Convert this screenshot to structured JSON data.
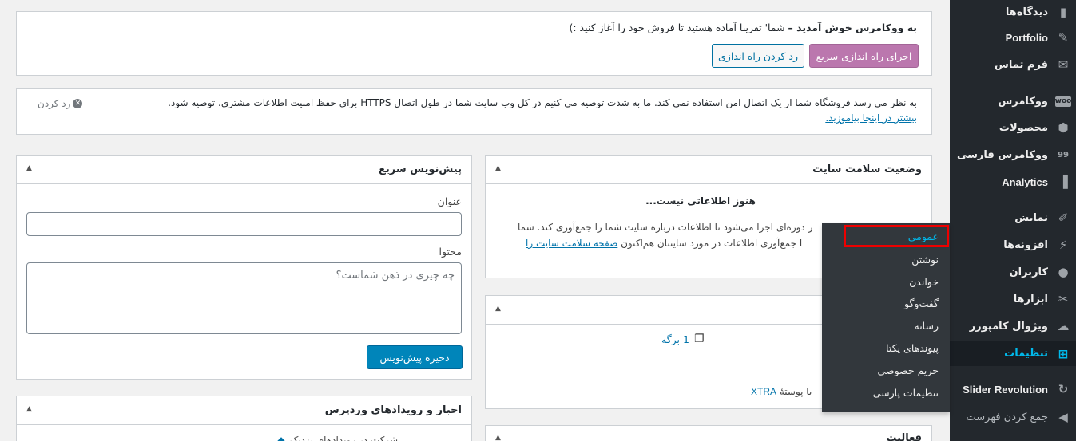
{
  "notices": {
    "welcome": {
      "title": "به ووکامرس خوش آمدید –",
      "text": "شما' تقریبا آماده هستید تا فروش خود را آغاز کنید :)",
      "primary_button": "اجرای راه اندازی سریع",
      "secondary_button": "رد کردن راه اندازی"
    },
    "https": {
      "text": "به نظر می رسد فروشگاه شما از یک اتصال امن استفاده نمی کند. ما به شدت توصیه می کنیم در کل وب سایت شما در طول اتصال HTTPS برای حفظ امنیت اطلاعات مشتری، توصیه شود.",
      "link": "بیشتر در اینجا بیاموزید.",
      "dismiss": "رد کردن"
    }
  },
  "site_health": {
    "title": "وضعیت سلامت سایت",
    "empty": "هنوز اطلاعاتی نیست...",
    "line1": "ر دوره‌ای اجرا می‌شود تا اطلاعات درباره سایت شما را جمع‌آوری کند. شما",
    "line2": "ا جمع‌آوری اطلاعات در مورد سایتتان هم‌اکنون",
    "link": "صفحه سلامت سایت را"
  },
  "at_a_glance": {
    "pages": "1 برگه",
    "theme_prefix": "با پوستهٔ",
    "theme_link": "XTRA"
  },
  "activity": {
    "title": "فعالیت"
  },
  "quick_draft": {
    "title": "پیش‌نویس سریع",
    "title_label": "عنوان",
    "content_label": "محتوا",
    "content_placeholder": "چه چیزی در ذهن شماست؟",
    "save_button": "ذخیره پیش‌نویس"
  },
  "news": {
    "title": "اخبار و رویدادهای وردپرس",
    "partial": "شرکت در رویدادهای نزدیک"
  },
  "sidebar": {
    "items": [
      {
        "label": "دیدگاه‌ها",
        "icon": "comment-icon"
      },
      {
        "label": "Portfolio",
        "icon": "pin-icon"
      },
      {
        "label": "فرم تماس",
        "icon": "mail-icon"
      },
      {
        "label": "ووکامرس",
        "icon": "woo-icon"
      },
      {
        "label": "محصولات",
        "icon": "box-icon"
      },
      {
        "label": "ووکامرس فارسی",
        "icon": "woo-persian-icon"
      },
      {
        "label": "Analytics",
        "icon": "bar-chart-icon"
      },
      {
        "label": "نمایش",
        "icon": "brush-icon"
      },
      {
        "label": "افزونه‌ها",
        "icon": "plug-icon"
      },
      {
        "label": "کاربران",
        "icon": "user-icon"
      },
      {
        "label": "ابزارها",
        "icon": "wrench-icon"
      },
      {
        "label": "ویژوال کامپوزر",
        "icon": "cloud-icon"
      },
      {
        "label": "تنظیمات",
        "icon": "settings-icon"
      },
      {
        "label": "Slider Revolution",
        "icon": "refresh-icon"
      },
      {
        "label": "جمع کردن فهرست",
        "icon": "collapse-icon"
      }
    ]
  },
  "flyout": {
    "items": [
      "عمومی",
      "نوشتن",
      "خواندن",
      "گفت‌وگو",
      "رسانه",
      "پیوندهای یکتا",
      "حریم خصوصی",
      "تنظیمات پارسی"
    ]
  },
  "colors": {
    "sidebar_bg": "#23282d",
    "flyout_bg": "#32373c",
    "accent": "#00b9eb",
    "woo_purple": "#bb77ae",
    "wp_blue": "#0085ba",
    "highlight": "#ee0000"
  }
}
